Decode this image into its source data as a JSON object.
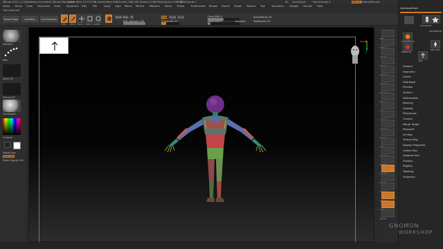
{
  "titlebar": {
    "title": "ZBrush 2021.1.2 [Madeleine Sylvestre] ZBrush Document",
    "meta1": "▸ Free Mem 13.572 GB",
    "meta2": "▸ Active Mem 813",
    "meta3": "▸ Scratch Disk 49",
    "meta4": "▸ Timer▸ 0.135",
    "meta5": "▸ PolyCount▸ 9.497 KP",
    "meta6": "▸ MeshCount▸ 1",
    "ac_label": "AC",
    "quicksave": "QuickSave",
    "see_through": "See-through  0",
    "menus_btn": "Menus",
    "script": "DefaultZScript"
  },
  "menubar": [
    "Alpha",
    "Brush",
    "Color",
    "Document",
    "Draw",
    "Dynamics",
    "Edit",
    "File",
    "Layer",
    "Light",
    "Macro",
    "Marker",
    "Material",
    "Movie",
    "Picker",
    "Preferences",
    "Render",
    "Stencil",
    "Stroke",
    "Texture",
    "Tool",
    "Transform",
    "Zplugin",
    "Zscript",
    "Help"
  ],
  "toolrow": {
    "text": "Tool switched"
  },
  "shelf": {
    "home_page": "Home Page",
    "lightbox": "LightBox",
    "live_boolean": "Live Boolean",
    "edit": "Edit",
    "draw": "Draw",
    "move": "Move",
    "scale": "Scale",
    "rotate": "Rotate",
    "mrgb": "Mrgb",
    "rgb": "Rgb",
    "m": "M",
    "zadd": "Zadd",
    "zsub": "Zsub",
    "zcut": "Zcut",
    "rgb_intensity": "Rgb Intensity 100",
    "z_intensity": "Z Intensity 25",
    "focal_shift": "Focal Shift 0",
    "draw_size": "Draw Size 9",
    "dynamic": "Dynamic",
    "active_points": "ActivePoints: 87",
    "total_points": "TotalPoints: 87"
  },
  "lefttray": {
    "brush_label": "Standard",
    "stroke_label": "Dots",
    "alpha_label": "Alpha Off",
    "texture_label": "Texture Off",
    "material_label": "SkinShade4",
    "gradient_label": "Gradient",
    "switch_color": "SwitchColor",
    "alternate": "Alternate",
    "model_opacity": "Model Opacity 100"
  },
  "rstrip": [
    "BPR",
    "SPix 3",
    "Scroll",
    "Zoom",
    "Actual",
    "AAHalf",
    "Dynamic",
    "Persp",
    "Floor",
    "Local",
    "L.Sym",
    "Frame",
    "Move",
    "ZoomD",
    "Rotate",
    "LineFill",
    "PolyF",
    "Transp",
    "Ghost",
    "Solo",
    "Xpose"
  ],
  "righttray": {
    "header": "Lightbox▸Tools",
    "tool_name": "Cylinder3D_1",
    "load_tool": "Load Tool",
    "save_as": "Save As",
    "import": "Import",
    "export": "Export",
    "clone": "Clone",
    "make_polymesh": "Make PolyMesh3D",
    "goz": "GoZ",
    "all": "All",
    "visible": "Visible",
    "tools": [
      {
        "name": "Cylinder3D_1"
      },
      {
        "name": "Cylinder3D"
      },
      {
        "name": "PolyMesh3D"
      },
      {
        "name": "SimpleBrush"
      },
      {
        "name": "Zspheres"
      },
      {
        "name": "Skin_ZS1"
      },
      {
        "name": "ZS1"
      }
    ],
    "subpalettes": [
      "Subtool",
      "Geometry",
      "Layers",
      "FiberMesh",
      "Preview",
      "Surface",
      "Deformation",
      "Masking",
      "Visibility",
      "Polygroups",
      "Contact",
      "Morph Target",
      "Polypaint",
      "UV Map",
      "Texture Map",
      "Display Properties",
      "Unified Skin",
      "Adaptive Skin",
      "ZSketch",
      "Rigging",
      "Topology",
      "Projection"
    ]
  },
  "watermark": {
    "line1": "GNOMON",
    "line2": "WORKSHOP"
  },
  "colors": {
    "accent_orange": "#d27a24",
    "bg": "#2a2a2a",
    "viewport_bg": "#000000"
  }
}
